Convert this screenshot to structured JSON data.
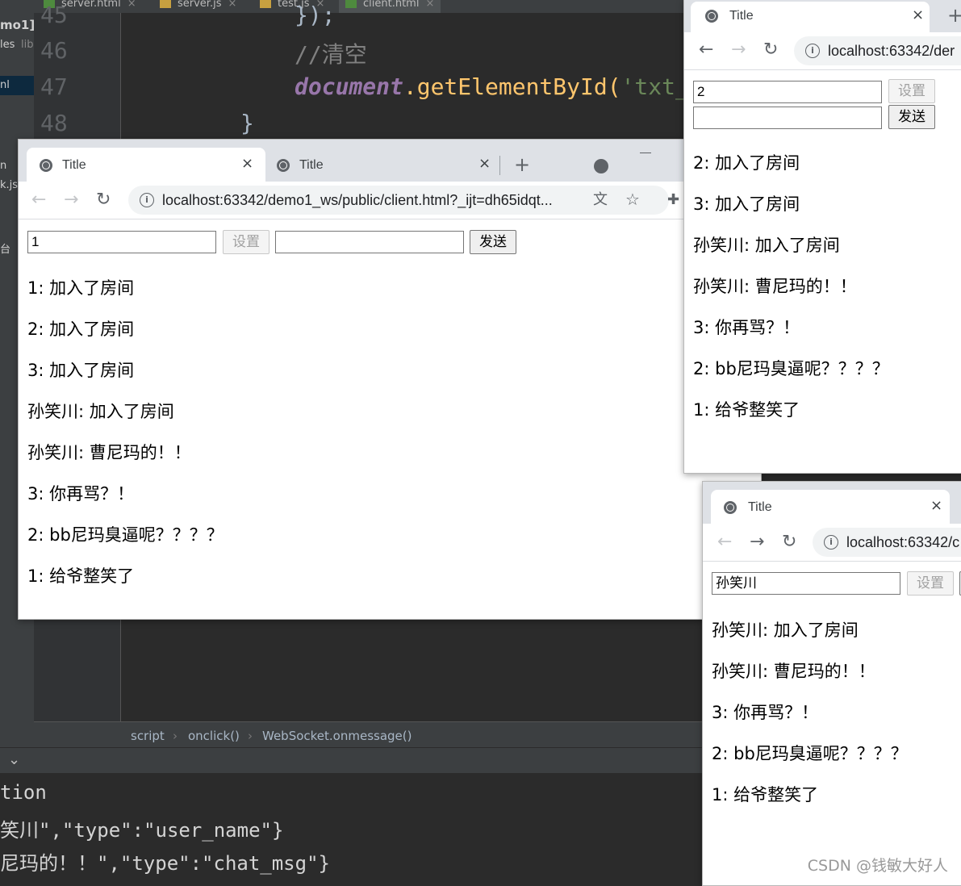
{
  "ide": {
    "tabs": [
      {
        "label": "server.html"
      },
      {
        "label": "server.js"
      },
      {
        "label": "test.js"
      },
      {
        "label": "client.html"
      }
    ],
    "side_fragments": [
      "mo1]",
      "les",
      "lib",
      "nl",
      "n",
      "k.js",
      "台"
    ],
    "line_numbers": [
      "45",
      "46",
      "47",
      "48"
    ],
    "code": {
      "line45": "});",
      "line46": "//清空",
      "line47_obj": "document",
      "line47_method": ".getElementById(",
      "line47_str": "'txt_",
      "line48": "}"
    },
    "breadcrumbs": [
      "script",
      "onclick()",
      "WebSocket.onmessage()"
    ],
    "console": [
      "tion",
      "笑川\",\"type\":\"user_name\"}",
      "尼玛的！！\",\"type\":\"chat_msg\"}"
    ]
  },
  "browser_main": {
    "tab_title": "Title",
    "tab2_title": "Title",
    "url": "localhost:63342/demo1_ws/public/client.html?_ijt=dh65idqt...",
    "name_value": "1",
    "set_label": "设置",
    "send_label": "发送",
    "messages": [
      "1: 加入了房间",
      "2: 加入了房间",
      "3: 加入了房间",
      "孙笑川: 加入了房间",
      "孙笑川: 曹尼玛的！！",
      "3: 你再骂？！",
      "2: bb尼玛臭逼呢？？？？",
      "1: 给爷整笑了"
    ]
  },
  "browser_right": {
    "tab_title": "Title",
    "url": "localhost:63342/der",
    "name_value": "2",
    "set_label": "设置",
    "send_label": "发送",
    "messages": [
      "2: 加入了房间",
      "3: 加入了房间",
      "孙笑川: 加入了房间",
      "孙笑川: 曹尼玛的！！",
      "3: 你再骂？！",
      "2: bb尼玛臭逼呢？？？？",
      "1: 给爷整笑了"
    ]
  },
  "browser_bottom": {
    "tab_title": "Title",
    "url": "localhost:63342/c",
    "name_value": "孙笑川",
    "set_label": "设置",
    "messages": [
      "孙笑川: 加入了房间",
      "孙笑川: 曹尼玛的！！",
      "3: 你再骂？！",
      "2: bb尼玛臭逼呢？？？？",
      "1: 给爷整笑了"
    ]
  },
  "watermark": "CSDN @钱敏大好人",
  "icons": {
    "back": "arrow-left-icon",
    "forward": "arrow-right-icon",
    "reload": "reload-icon",
    "info": "info-icon",
    "translate": "translate-icon",
    "star": "star-icon",
    "extensions": "puzzle-icon",
    "globe": "globe-icon"
  },
  "colors": {
    "ide_bg": "#2b2b2b",
    "keyword_purple": "#9876aa",
    "method_yellow": "#ffc66d",
    "string_green": "#6a8759",
    "comment_gray": "#808080"
  }
}
